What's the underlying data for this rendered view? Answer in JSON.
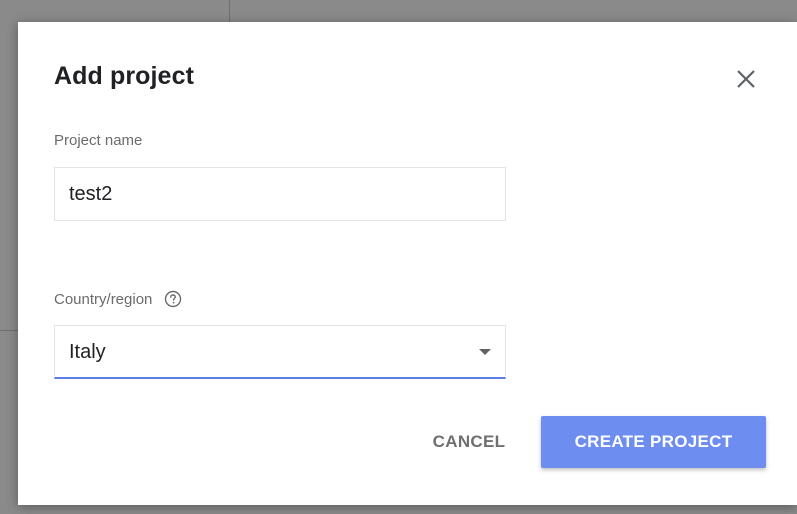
{
  "dialog": {
    "title": "Add project",
    "close_icon": "close-icon"
  },
  "project_name": {
    "label": "Project name",
    "value": "test2"
  },
  "country": {
    "label": "Country/region",
    "help_icon": "help-circle-icon",
    "selected": "Italy"
  },
  "actions": {
    "cancel_label": "CANCEL",
    "create_label": "CREATE PROJECT"
  },
  "colors": {
    "primary": "#6d8ef0",
    "focus_underline": "#5c7ee8",
    "backdrop": "#8a8a8a"
  }
}
